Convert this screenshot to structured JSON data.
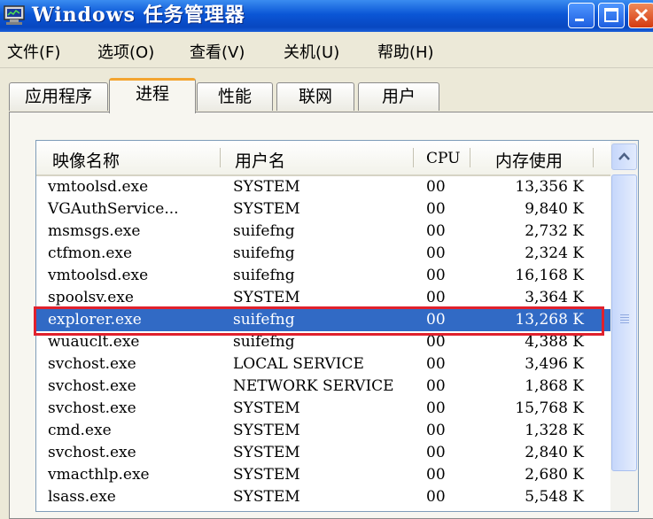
{
  "window": {
    "title": "Windows 任务管理器",
    "colors": {
      "title_bar": "#0a56d6",
      "selection": "#316ac5",
      "highlight_box": "#e0212d"
    }
  },
  "menu": [
    {
      "label": "文件(F)"
    },
    {
      "label": "选项(O)"
    },
    {
      "label": "查看(V)"
    },
    {
      "label": "关机(U)"
    },
    {
      "label": "帮助(H)"
    }
  ],
  "tabs": [
    {
      "label": "应用程序",
      "active": false
    },
    {
      "label": "进程",
      "active": true
    },
    {
      "label": "性能",
      "active": false
    },
    {
      "label": "联网",
      "active": false
    },
    {
      "label": "用户",
      "active": false
    }
  ],
  "table": {
    "columns": [
      "映像名称",
      "用户名",
      "CPU",
      "内存使用"
    ],
    "rows": [
      {
        "name": "vmtoolsd.exe",
        "user": "SYSTEM",
        "cpu": "00",
        "mem": "13,356 K"
      },
      {
        "name": "VGAuthService...",
        "user": "SYSTEM",
        "cpu": "00",
        "mem": "9,840 K"
      },
      {
        "name": "msmsgs.exe",
        "user": "suifefng",
        "cpu": "00",
        "mem": "2,732 K"
      },
      {
        "name": "ctfmon.exe",
        "user": "suifefng",
        "cpu": "00",
        "mem": "2,324 K"
      },
      {
        "name": "vmtoolsd.exe",
        "user": "suifefng",
        "cpu": "00",
        "mem": "16,168 K"
      },
      {
        "name": "spoolsv.exe",
        "user": "SYSTEM",
        "cpu": "00",
        "mem": "3,364 K"
      },
      {
        "name": "explorer.exe",
        "user": "suifefng",
        "cpu": "00",
        "mem": "13,268 K",
        "selected": true
      },
      {
        "name": "wuauclt.exe",
        "user": "suifefng",
        "cpu": "00",
        "mem": "4,388 K"
      },
      {
        "name": "svchost.exe",
        "user": "LOCAL SERVICE",
        "cpu": "00",
        "mem": "3,496 K"
      },
      {
        "name": "svchost.exe",
        "user": "NETWORK SERVICE",
        "cpu": "00",
        "mem": "1,868 K"
      },
      {
        "name": "svchost.exe",
        "user": "SYSTEM",
        "cpu": "00",
        "mem": "15,768 K"
      },
      {
        "name": "cmd.exe",
        "user": "SYSTEM",
        "cpu": "00",
        "mem": "1,328 K"
      },
      {
        "name": "svchost.exe",
        "user": "SYSTEM",
        "cpu": "00",
        "mem": "2,840 K"
      },
      {
        "name": "vmacthlp.exe",
        "user": "SYSTEM",
        "cpu": "00",
        "mem": "2,680 K"
      },
      {
        "name": "lsass.exe",
        "user": "SYSTEM",
        "cpu": "00",
        "mem": "5,548 K"
      }
    ]
  }
}
